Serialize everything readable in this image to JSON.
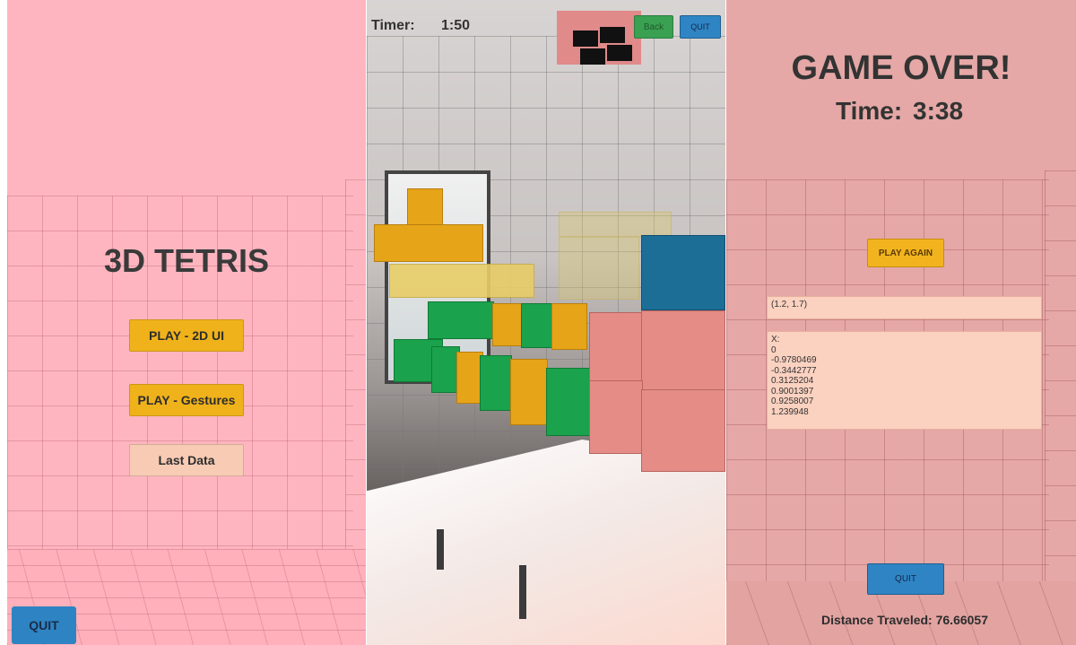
{
  "menu": {
    "title": "3D TETRIS",
    "play_2d_label": "PLAY - 2D UI",
    "play_gestures_label": "PLAY - Gestures",
    "last_data_label": "Last Data",
    "quit_label": "QUIT"
  },
  "game": {
    "timer_label": "Timer:",
    "timer_value": "1:50",
    "back_label": "Back",
    "quit_label": "QUIT"
  },
  "game_over": {
    "title": "GAME OVER!",
    "time_label": "Time:",
    "time_value": "3:38",
    "play_again_label": "PLAY AGAIN",
    "coordinates": "(1.2, 1.7)",
    "data_lines": [
      "X:",
      "0",
      "-0.9780469",
      "-0.3442777",
      "0.3125204",
      "0.9001397",
      "0.9258007",
      "1.239948"
    ],
    "quit_label": "QUIT",
    "distance_label": "Distance Traveled:",
    "distance_value": "76.66057"
  },
  "colors": {
    "menu_background": "#ffb5bf",
    "gold_button": "#f0b21a",
    "peach_button": "#f7cbb4",
    "blue_button": "#2e84c2",
    "game_over_background": "#e5a8a6"
  }
}
